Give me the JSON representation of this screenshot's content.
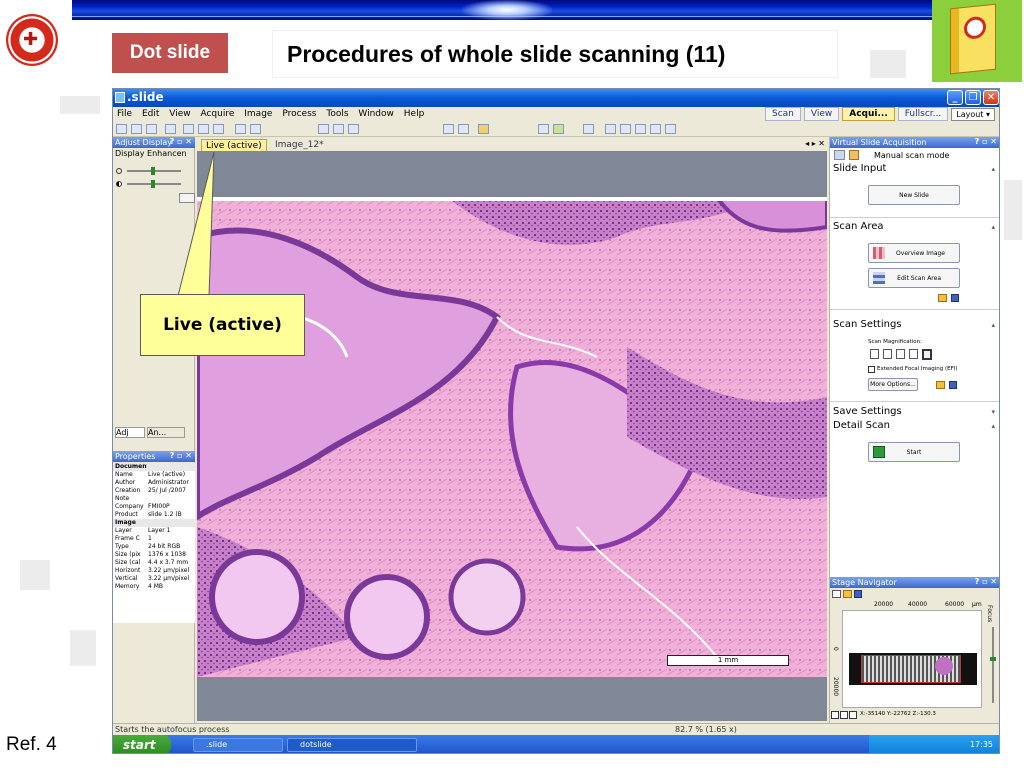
{
  "slide": {
    "tag": "Dot slide",
    "title": "Procedures of whole slide scanning (11)",
    "ref": "Ref. 4",
    "callout": "Live (active)"
  },
  "app": {
    "title": ".slide",
    "menu": [
      "File",
      "Edit",
      "View",
      "Acquire",
      "Image",
      "Process",
      "Tools",
      "Window",
      "Help"
    ],
    "mode_tabs": [
      "Scan",
      "View",
      "Acqui...",
      "Fullscr..."
    ],
    "layout_button": "Layout",
    "left_panel": {
      "title": "Adjust Display",
      "subtitle": "Display Enhancen",
      "tabs": [
        "Adj",
        "An..."
      ]
    },
    "properties": {
      "title": "Properties",
      "document_header": "Document",
      "document": [
        [
          "Name",
          "Live (active)"
        ],
        [
          "Author",
          "Administrator"
        ],
        [
          "Creation",
          "25/ Jul /2007"
        ],
        [
          "Note",
          ""
        ],
        [
          "Company",
          "FMI00P"
        ],
        [
          "Product",
          "slide 1.2 (B"
        ]
      ],
      "image_header": "Image",
      "image": [
        [
          "Layer",
          "Layer 1"
        ],
        [
          "Frame C",
          "1"
        ],
        [
          "Type",
          "24 bit RGB"
        ],
        [
          "Size (pix",
          "1376 x 1038"
        ],
        [
          "Size (cal",
          "4.4 x 3.7 mm"
        ],
        [
          "Horizont",
          "3.22 µm/pixel"
        ],
        [
          "Vertical",
          "3.22 µm/pixel"
        ],
        [
          "Memory",
          "4 MB"
        ]
      ]
    },
    "doc_tabs": [
      "Live (active)",
      "Image_12*"
    ],
    "scale_bar": "1 mm",
    "right_panel": {
      "title": "Virtual Slide Acquisition",
      "mode": "Manual scan mode",
      "slide_input": "Slide Input",
      "new_slide": "New Slide",
      "scan_area": "Scan Area",
      "overview_image": "Overview Image",
      "edit_scan_area": "Edit Scan Area",
      "scan_settings": "Scan Settings",
      "scan_magnification": "Scan Magnification:",
      "efi": "Extended Focal Imaging (EFI)",
      "more_options": "More Options...",
      "save_settings": "Save Settings",
      "detail_scan": "Detail Scan",
      "start": "Start"
    },
    "navigator": {
      "title": "Stage Navigator",
      "x_ticks": [
        "20000",
        "40000",
        "60000"
      ],
      "x_unit": "µm",
      "focus_label": "Focus",
      "y_ticks": [
        "0",
        "20000"
      ],
      "coords": "X:-35140 Y:-22762 Z:-130.3"
    },
    "status": {
      "left": "Starts the autofocus process",
      "zoom": "82.7 % (1.65 x)"
    },
    "taskbar": {
      "start": "start",
      "tasks": [
        ".slide",
        "dotslide"
      ],
      "clock": "17:35"
    }
  }
}
